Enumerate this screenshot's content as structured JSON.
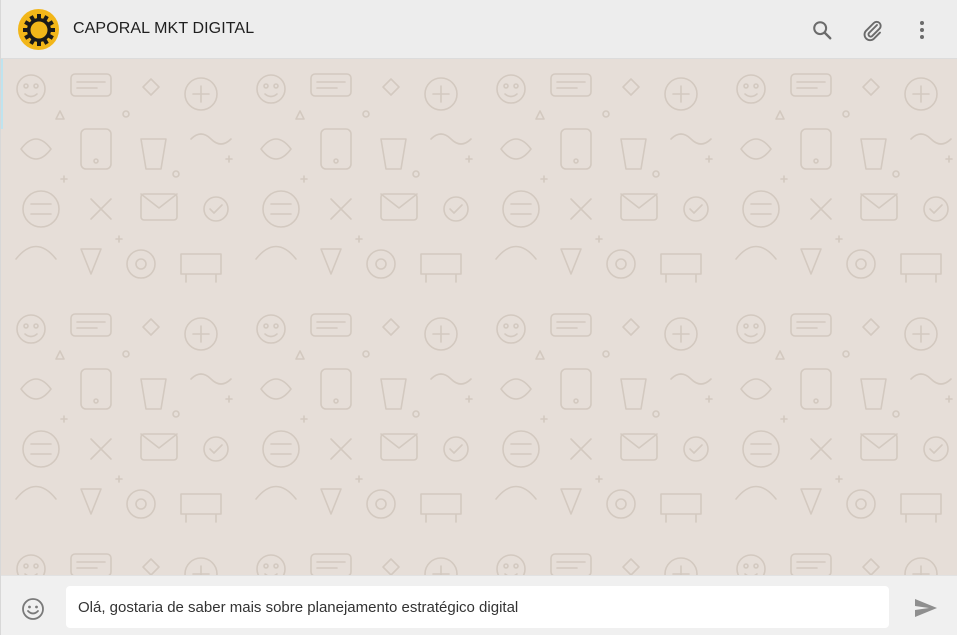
{
  "header": {
    "contact_name": "CAPORAL MKT DIGITAL",
    "icons": [
      "search-icon",
      "paperclip-icon",
      "more-vertical-icon"
    ]
  },
  "avatar": {
    "background": "#f2b619",
    "icon": "gear-logo"
  },
  "chat": {
    "wallpaper_color": "#e6ded8",
    "pattern_color": "#d6cdc5"
  },
  "composer": {
    "input_value": "Olá, gostaria de saber mais sobre planejamento estratégico digital",
    "emoji_icon": "smiley-icon",
    "send_icon": "send-icon"
  }
}
